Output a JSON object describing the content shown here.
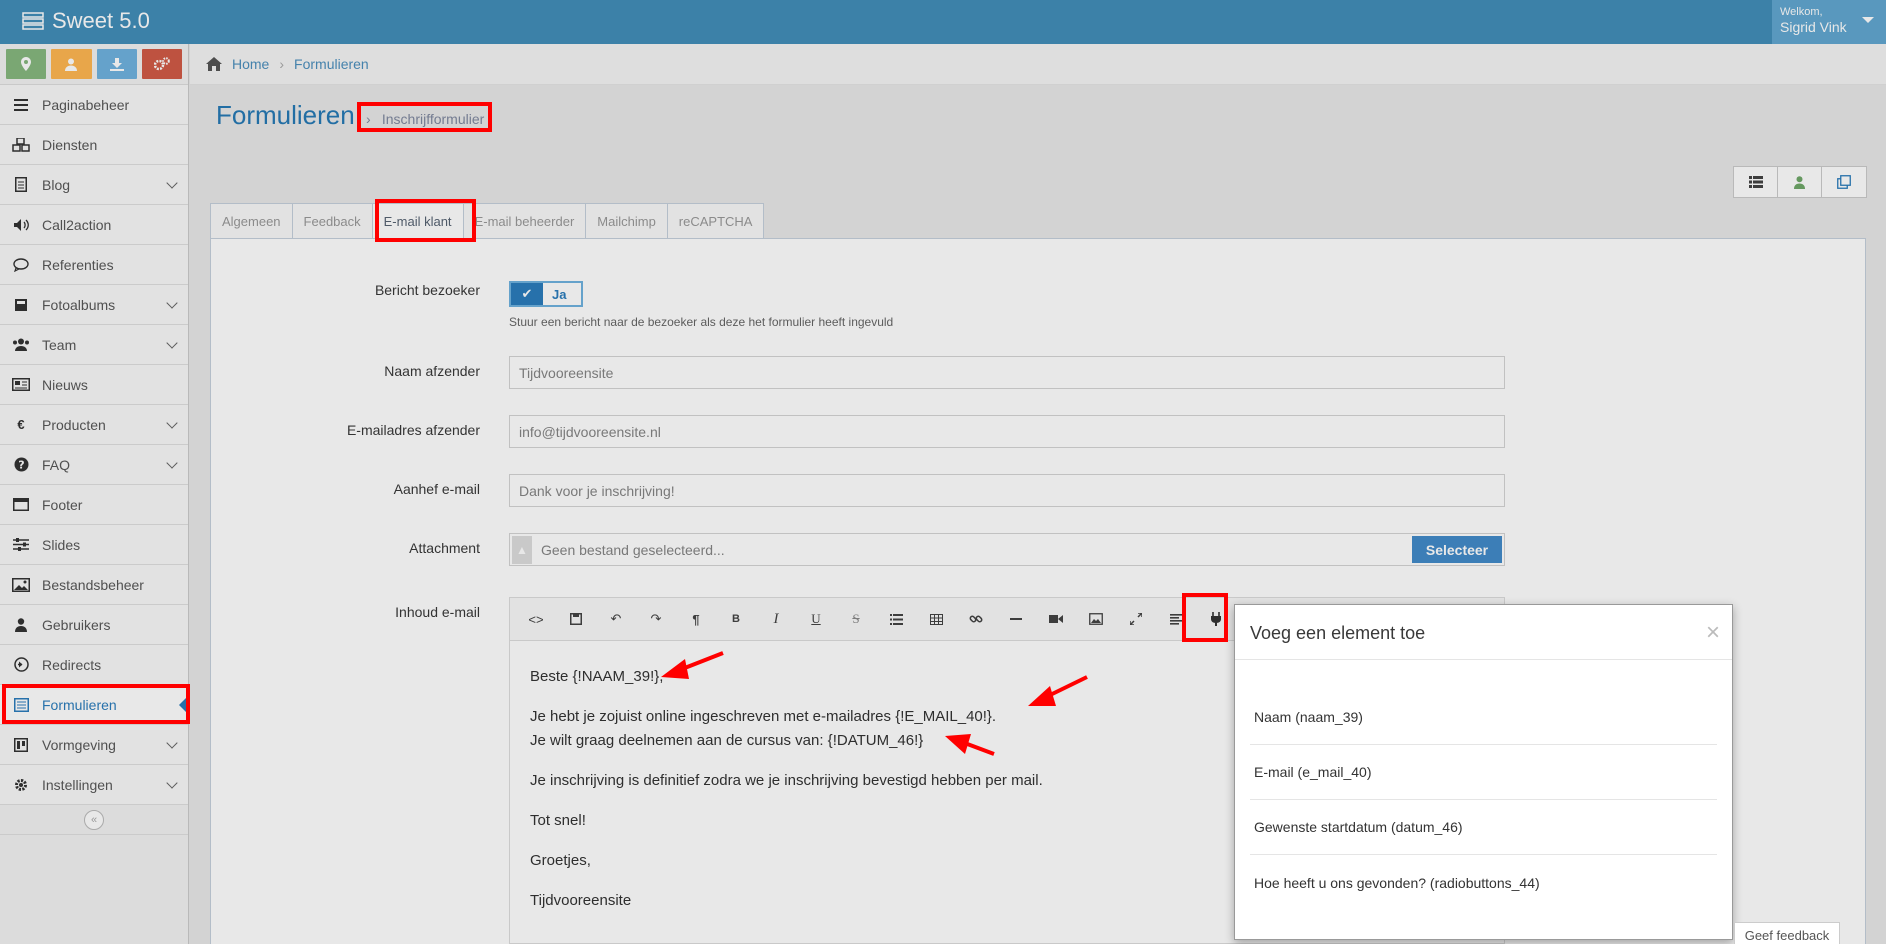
{
  "app": {
    "title": "Sweet 5.0",
    "welcome_label": "Welkom,",
    "user_name": "Sigrid Vink"
  },
  "sidebar": {
    "shortcuts": [
      {
        "icon": "map-marker-icon",
        "color": "#87b87f"
      },
      {
        "icon": "user-icon",
        "color": "#ffb752"
      },
      {
        "icon": "download-icon",
        "color": "#6fb3e0"
      },
      {
        "icon": "cogs-icon",
        "color": "#d15b47"
      }
    ],
    "items": [
      {
        "label": "Paginabeheer",
        "icon": "bars-icon",
        "has_sub": false
      },
      {
        "label": "Diensten",
        "icon": "cubes-icon",
        "has_sub": false
      },
      {
        "label": "Blog",
        "icon": "file-text-icon",
        "has_sub": true
      },
      {
        "label": "Call2action",
        "icon": "volume-icon",
        "has_sub": false
      },
      {
        "label": "Referenties",
        "icon": "comment-icon",
        "has_sub": false
      },
      {
        "label": "Fotoalbums",
        "icon": "book-icon",
        "has_sub": true
      },
      {
        "label": "Team",
        "icon": "users-icon",
        "has_sub": true
      },
      {
        "label": "Nieuws",
        "icon": "newspaper-icon",
        "has_sub": false
      },
      {
        "label": "Producten",
        "icon": "euro-icon",
        "has_sub": true
      },
      {
        "label": "FAQ",
        "icon": "question-icon",
        "has_sub": true
      },
      {
        "label": "Footer",
        "icon": "window-icon",
        "has_sub": false
      },
      {
        "label": "Slides",
        "icon": "sliders-icon",
        "has_sub": false
      },
      {
        "label": "Bestandsbeheer",
        "icon": "image-icon",
        "has_sub": false
      },
      {
        "label": "Gebruikers",
        "icon": "user-icon",
        "has_sub": false
      },
      {
        "label": "Redirects",
        "icon": "arrow-circle-icon",
        "has_sub": false
      },
      {
        "label": "Formulieren",
        "icon": "list-alt-icon",
        "has_sub": false,
        "active": true
      },
      {
        "label": "Vormgeving",
        "icon": "trello-icon",
        "has_sub": true
      },
      {
        "label": "Instellingen",
        "icon": "gear-icon",
        "has_sub": true
      }
    ]
  },
  "breadcrumb": {
    "home": "Home",
    "current": "Formulieren"
  },
  "page": {
    "title": "Formulieren",
    "separator": "›",
    "subtitle": "Inschrijfformulier"
  },
  "tabs": [
    {
      "label": "Algemeen"
    },
    {
      "label": "Feedback"
    },
    {
      "label": "E-mail klant",
      "active": true
    },
    {
      "label": "E-mail beheerder"
    },
    {
      "label": "Mailchimp"
    },
    {
      "label": "reCAPTCHA"
    }
  ],
  "form": {
    "bericht_label": "Bericht bezoeker",
    "bericht_toggle": "Ja",
    "bericht_help": "Stuur een bericht naar de bezoeker als deze het formulier heeft ingevuld",
    "naam_label": "Naam afzender",
    "naam_value": "Tijdvooreensite",
    "email_label": "E-mailadres afzender",
    "email_value": "info@tijdvooreensite.nl",
    "aanhef_label": "Aanhef e-mail",
    "aanhef_value": "Dank voor je inschrijving!",
    "attachment_label": "Attachment",
    "attachment_placeholder": "Geen bestand geselecteerd...",
    "attachment_button": "Selecteer",
    "inhoud_label": "Inhoud e-mail"
  },
  "editor": {
    "toolbar": [
      "code-icon",
      "save-icon",
      "undo-icon",
      "redo-icon",
      "paragraph-icon",
      "bold-icon",
      "italic-icon",
      "underline-icon",
      "strikethrough-icon",
      "list-icon",
      "table-icon",
      "link-icon",
      "horizontal-rule-icon",
      "video-icon",
      "image-icon",
      "fullscreen-icon",
      "align-icon",
      "plugin-icon"
    ],
    "lines": {
      "l1": "Beste {!NAAM_39!},",
      "l2": "Je hebt je zojuist online ingeschreven met e-mailadres {!E_MAIL_40!}.",
      "l3": "Je wilt graag deelnemen aan de cursus van: {!DATUM_46!}",
      "l4": "Je inschrijving is definitief zodra we je inschrijving bevestigd hebben per mail.",
      "l5": "Tot snel!",
      "l6": "Groetjes,",
      "l7": "Tijdvooreensite"
    }
  },
  "modal": {
    "title": "Voeg een element toe",
    "close": "×",
    "items": [
      {
        "label": "Naam (naam_39)"
      },
      {
        "label": "E-mail (e_mail_40)"
      },
      {
        "label": "Gewenste startdatum (datum_46)"
      },
      {
        "label": "Hoe heeft u ons gevonden? (radiobuttons_44)"
      }
    ]
  },
  "feedback_button": "Geef feedback",
  "colors": {
    "topbar": "#438eb9",
    "accent": "#2b7dbc",
    "annotation": "#ff0000"
  }
}
